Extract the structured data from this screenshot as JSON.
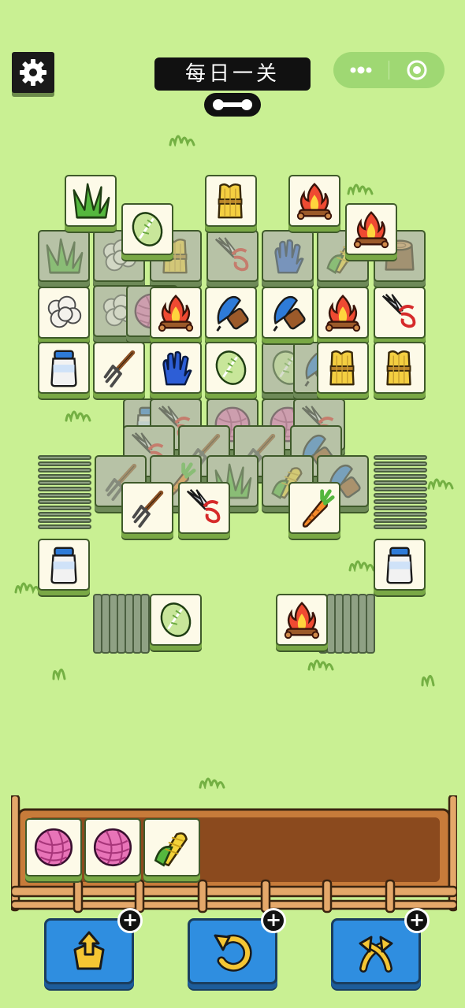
{
  "header": {
    "title": "每日一关",
    "settings_icon": "gear-icon",
    "progress_icon": "dumbbell-icon",
    "more_icon": "more-dots-icon",
    "close_icon": "target-circle-icon"
  },
  "board": {
    "tile_types": [
      "grass",
      "cabbage",
      "wheat",
      "campfire",
      "tree-stump",
      "wool",
      "yarn",
      "comb",
      "glove",
      "shears",
      "milk",
      "pitchfork",
      "carrot",
      "corn"
    ],
    "stacks": {
      "left_side_count": 12,
      "right_side_count": 12,
      "bottom_left_count": 7,
      "bottom_right_count": 7
    }
  },
  "tray": {
    "capacity": 7,
    "slots": [
      {
        "item": "yarn"
      },
      {
        "item": "yarn"
      },
      {
        "item": "corn"
      }
    ]
  },
  "tools": [
    {
      "name": "move-out",
      "icon": "move-out-icon",
      "badge": "+"
    },
    {
      "name": "undo",
      "icon": "undo-icon",
      "badge": "+"
    },
    {
      "name": "shuffle",
      "icon": "shuffle-icon",
      "badge": "+"
    }
  ],
  "colors": {
    "background": "#c9f093",
    "tile_face": "#fdfae8",
    "tile_side": "#79a845",
    "tray_wood": "#8b4a1e",
    "tool_button": "#2f8ee0"
  }
}
